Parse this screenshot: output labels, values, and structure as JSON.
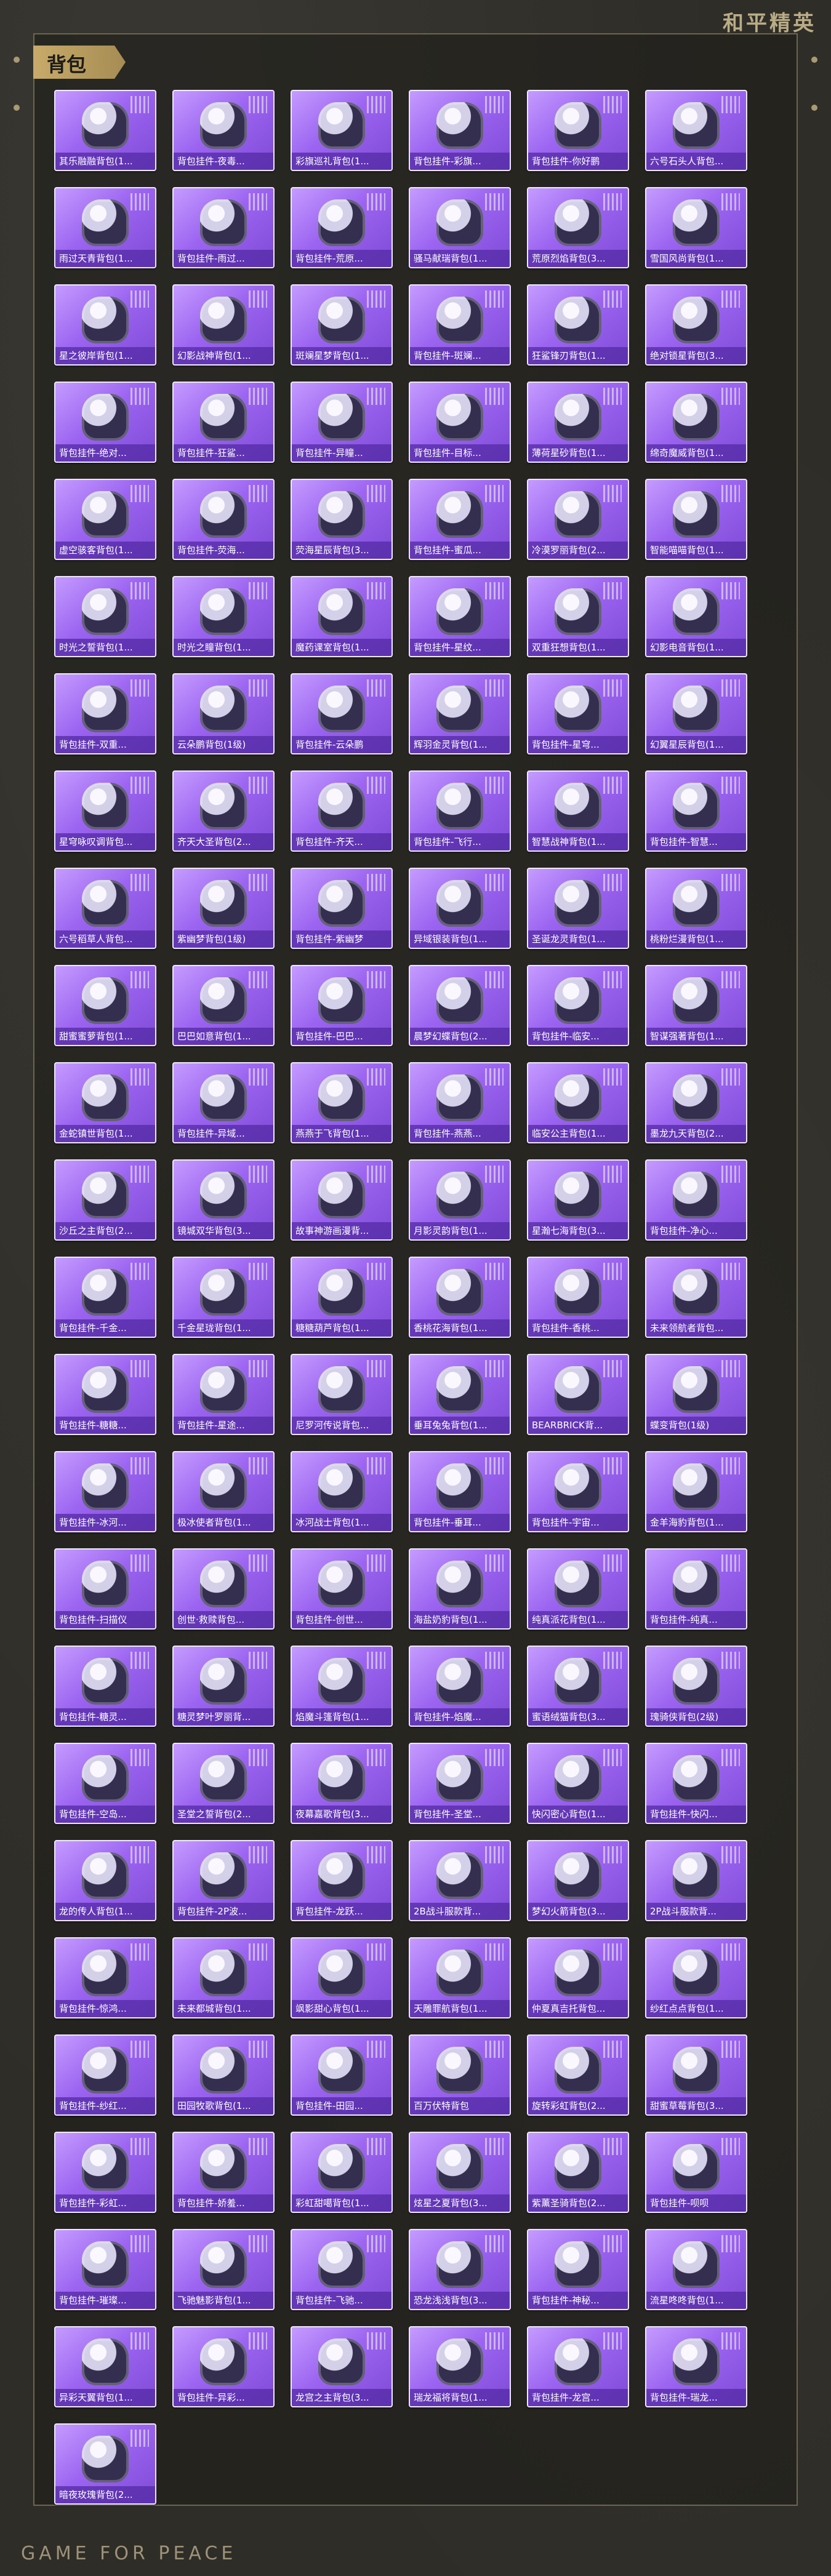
{
  "header": {
    "brand_top": "和平精英",
    "section_title": "背包"
  },
  "footer": {
    "brand_bottom": "GAME FOR PEACE"
  },
  "items": [
    "其乐融融背包(1...",
    "背包挂件-夜毒...",
    "彩旗巡礼背包(1...",
    "背包挂件-彩旗...",
    "背包挂件-你好鹏",
    "六号石头人背包...",
    "雨过天青背包(1...",
    "背包挂件-雨过...",
    "背包挂件-荒原...",
    "骚马献瑞背包(1...",
    "荒原烈焰背包(3...",
    "雪国风尚背包(1...",
    "星之彼岸背包(1...",
    "幻影战神背包(1...",
    "斑斓星梦背包(1...",
    "背包挂件-斑斓...",
    "狂鲨锋刃背包(1...",
    "绝对锁星背包(3...",
    "背包挂件-绝对...",
    "背包挂件-狂鲨...",
    "背包挂件-异瞳...",
    "背包挂件-目标...",
    "薄荷星砂背包(1...",
    "绵奇魔威背包(1...",
    "虚空骇客背包(1...",
    "背包挂件-荧海...",
    "荧海星辰背包(3...",
    "背包挂件-蜜瓜...",
    "冷漠罗丽背包(2...",
    "智能喵喵背包(1...",
    "时光之誓背包(1...",
    "时光之瞳背包(1...",
    "魔药课室背包(1...",
    "背包挂件-星纹...",
    "双重狂想背包(1...",
    "幻影电音背包(1...",
    "背包挂件-双重...",
    "云朵鹏背包(1级)",
    "背包挂件-云朵鹏",
    "辉羽金灵背包(1...",
    "背包挂件-星穹...",
    "幻翼星辰背包(1...",
    "星穹咏叹调背包...",
    "齐天大圣背包(2...",
    "背包挂件-齐天...",
    "背包挂件-飞行...",
    "智慧战神背包(1...",
    "背包挂件-智慧...",
    "六号稻草人背包...",
    "紫幽梦背包(1级)",
    "背包挂件-紫幽梦",
    "异域银装背包(1...",
    "圣诞龙灵背包(1...",
    "桃粉烂漫背包(1...",
    "甜蜜蜜萝背包(1...",
    "巴巴如意背包(1...",
    "背包挂件-巴巴...",
    "晨梦幻蝶背包(2...",
    "背包挂件-临安...",
    "智谋强著背包(1...",
    "金蛇镇世背包(1...",
    "背包挂件-异域...",
    "燕燕于飞背包(1...",
    "背包挂件-燕燕...",
    "临安公主背包(1...",
    "墨龙九天背包(2...",
    "沙丘之主背包(2...",
    "镜城双华背包(3...",
    "故事神游画漫背...",
    "月影灵韵背包(1...",
    "星瀚七海背包(3...",
    "背包挂件-净心...",
    "背包挂件-千金...",
    "千金星珑背包(1...",
    "糖糖葫芦背包(1...",
    "香桃花海背包(1...",
    "背包挂件-香桃...",
    "未来领航者背包...",
    "背包挂件-糖糖...",
    "背包挂件-星途...",
    "尼罗河传说背包...",
    "垂耳兔兔背包(1...",
    "BEARBRICK背...",
    "蝶变背包(1级)",
    "背包挂件-冰河...",
    "极冰使者背包(1...",
    "冰河战士背包(1...",
    "背包挂件-垂耳...",
    "背包挂件-宇宙...",
    "金羊海豹背包(1...",
    "背包挂件-扫描仪",
    "创世·救赎背包...",
    "背包挂件-创世...",
    "海盐奶豹背包(1...",
    "纯真派花背包(1...",
    "背包挂件-纯真...",
    "背包挂件-糖灵...",
    "糖灵梦叶罗丽背...",
    "焰魔斗篷背包(1...",
    "背包挂件-焰魔...",
    "蜜语绒猫背包(3...",
    "瑰骑侠背包(2级)",
    "背包挂件-空岛...",
    "圣堂之誓背包(2...",
    "夜幕嘉歌背包(3...",
    "背包挂件-圣堂...",
    "快闪密心背包(1...",
    "背包挂件-快闪...",
    "龙的传人背包(1...",
    "背包挂件-2P波...",
    "背包挂件-龙跃...",
    "2B战斗服款背...",
    "梦幻火箭背包(3...",
    "2P战斗服款背...",
    "背包挂件-惊鸿...",
    "未来都城背包(1...",
    "飒影甜心背包(1...",
    "天雕罪航背包(1...",
    "仲夏真吉托背包...",
    "纱红点点背包(1...",
    "背包挂件-纱红...",
    "田园牧歌背包(1...",
    "背包挂件-田园...",
    "百万伏特背包",
    "旋转彩虹背包(2...",
    "甜蜜草莓背包(3...",
    "背包挂件-彩虹...",
    "背包挂件-娇羞...",
    "彩虹甜噶背包(1...",
    "炫星之夏背包(3...",
    "紫薰圣骑背包(2...",
    "背包挂件-呗呗",
    "背包挂件-璀璨...",
    "飞驰魅影背包(1...",
    "背包挂件-飞驰...",
    "恐龙浅浅背包(3...",
    "背包挂件-神秘...",
    "流星咚咚背包(1...",
    "异彩天翼背包(1...",
    "背包挂件-异彩...",
    "龙宫之主背包(3...",
    "瑞龙福将背包(1...",
    "背包挂件-龙宫...",
    "背包挂件-瑞龙...",
    "暗夜玫瑰背包(2..."
  ]
}
